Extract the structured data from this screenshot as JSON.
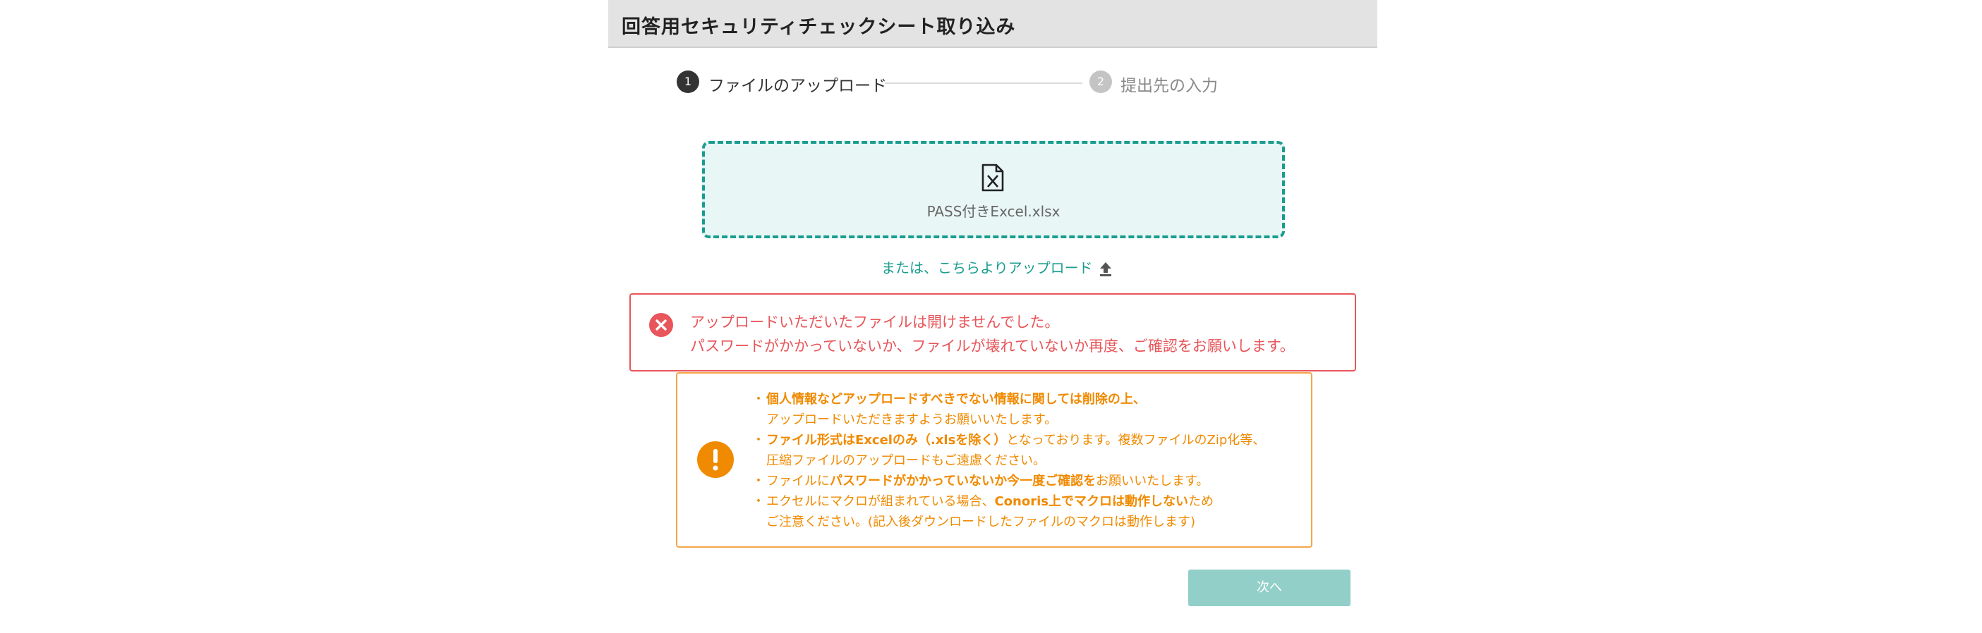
{
  "header": {
    "title": "回答用セキュリティチェックシート取り込み"
  },
  "stepper": {
    "steps": [
      {
        "number": "1",
        "label": "ファイルのアップロード",
        "state": "active"
      },
      {
        "number": "2",
        "label": "提出先の入力",
        "state": "inactive"
      }
    ]
  },
  "dropzone": {
    "file_icon": "excel-file-icon",
    "file_name": "PASS付きExcel.xlsx"
  },
  "upload_link": {
    "label": "または、こちらよりアップロード",
    "icon": "upload-icon"
  },
  "error": {
    "icon": "error-x-icon",
    "line1": "アップロードいただいたファイルは開けませんでした。",
    "line2": "パスワードがかかっていないか、ファイルが壊れていないか再度、ご確認をお願いします。"
  },
  "notice": {
    "icon": "exclamation-icon",
    "items": [
      {
        "bold": "個人情報などアップロードすべきでない情報に関しては削除の上、",
        "sub": "アップロードいただきますようお願いいたします。"
      },
      {
        "bold": "ファイル形式はExcelのみ（.xlsを除く）",
        "text": "となっております。複数ファイルのZip化等、",
        "sub": "圧縮ファイルのアップロードもご遠慮ください。"
      },
      {
        "pre": "ファイルに",
        "bold": "パスワードがかかっていないか今一度ご確認を",
        "text": "お願いいたします。"
      },
      {
        "pre": "エクセルにマクロが組まれている場合、",
        "bold": "Conoris上でマクロは動作しない",
        "text": "ため",
        "sub": "ご注意ください。(記入後ダウンロードしたファイルのマクロは動作します)"
      }
    ]
  },
  "next_button": {
    "label": "次へ"
  },
  "colors": {
    "accent": "#1a9d8f",
    "error": "#e8555a",
    "warning": "#f08a00",
    "button_disabled": "#93cfc9"
  }
}
